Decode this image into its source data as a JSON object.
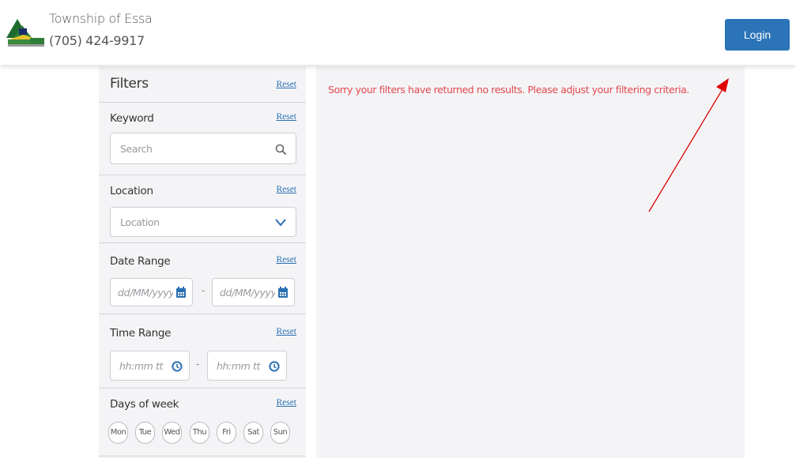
{
  "header": {
    "org_name": "Township of Essa",
    "phone": "(705) 424-9917",
    "login_label": "Login",
    "accent_color": "#2b74b8"
  },
  "filters": {
    "title": "Filters",
    "reset_label": "Reset",
    "keyword": {
      "label": "Keyword",
      "placeholder": "Search",
      "icon": "search-icon"
    },
    "location": {
      "label": "Location",
      "placeholder": "Location",
      "icon": "chevron-down-icon"
    },
    "date_range": {
      "label": "Date Range",
      "from_placeholder": "dd/MM/yyyy",
      "to_placeholder": "dd/MM/yyyy",
      "separator": "-",
      "icon": "calendar-icon"
    },
    "time_range": {
      "label": "Time Range",
      "from_placeholder": "hh:mm tt",
      "to_placeholder": "hh:mm tt",
      "separator": "-",
      "icon": "clock-icon"
    },
    "days_of_week": {
      "label": "Days of week",
      "days": [
        "Mon",
        "Tue",
        "Wed",
        "Thu",
        "Fri",
        "Sat",
        "Sun"
      ]
    }
  },
  "results": {
    "message": "Sorry your filters have returned no results. Please adjust your filtering criteria.",
    "message_color": "#e2484f"
  },
  "annotation": {
    "color": "#e00000",
    "icon": "arrow-annotation"
  }
}
